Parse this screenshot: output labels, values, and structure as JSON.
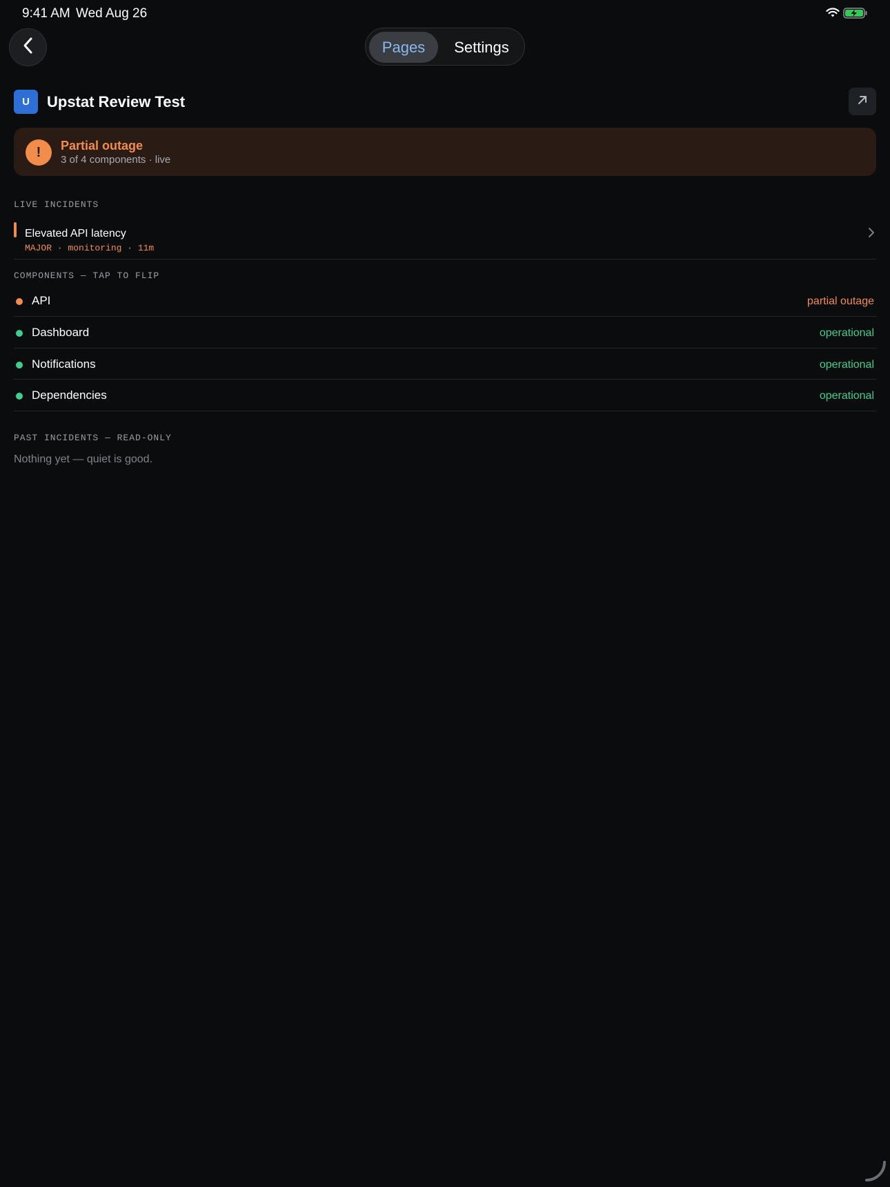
{
  "status_bar": {
    "time": "9:41 AM",
    "date": "Wed Aug 26"
  },
  "nav": {
    "back_icon": "chevron-left-icon",
    "tabs": [
      {
        "label": "Pages",
        "selected": true
      },
      {
        "label": "Settings",
        "selected": false
      }
    ]
  },
  "page": {
    "avatar_letter": "U",
    "title": "Upstat Review Test",
    "open_icon": "arrow-up-right-icon"
  },
  "status_card": {
    "icon": "exclamation-icon",
    "icon_glyph": "!",
    "title": "Partial outage",
    "subtitle": "3 of 4 components · live",
    "accent": "#f28c4b"
  },
  "live_incidents": {
    "label": "LIVE INCIDENTS",
    "items": [
      {
        "title": "Elevated API latency",
        "meta": "MAJOR · monitoring · 11m"
      }
    ]
  },
  "components": {
    "label": "COMPONENTS — TAP TO FLIP",
    "items": [
      {
        "name": "API",
        "state": "partial outage",
        "color": "#f28c4b"
      },
      {
        "name": "Dashboard",
        "state": "operational",
        "color": "#3ecf8e"
      },
      {
        "name": "Notifications",
        "state": "operational",
        "color": "#3ecf8e"
      },
      {
        "name": "Dependencies",
        "state": "operational",
        "color": "#3ecf8e"
      }
    ]
  },
  "past_incidents": {
    "label": "PAST INCIDENTS — READ-ONLY",
    "empty_text": "Nothing yet — quiet is good."
  },
  "colors": {
    "accent_orange": "#f28c4b",
    "operational_green": "#3ecf8e",
    "selected_tab_text": "#8ab8ee"
  }
}
